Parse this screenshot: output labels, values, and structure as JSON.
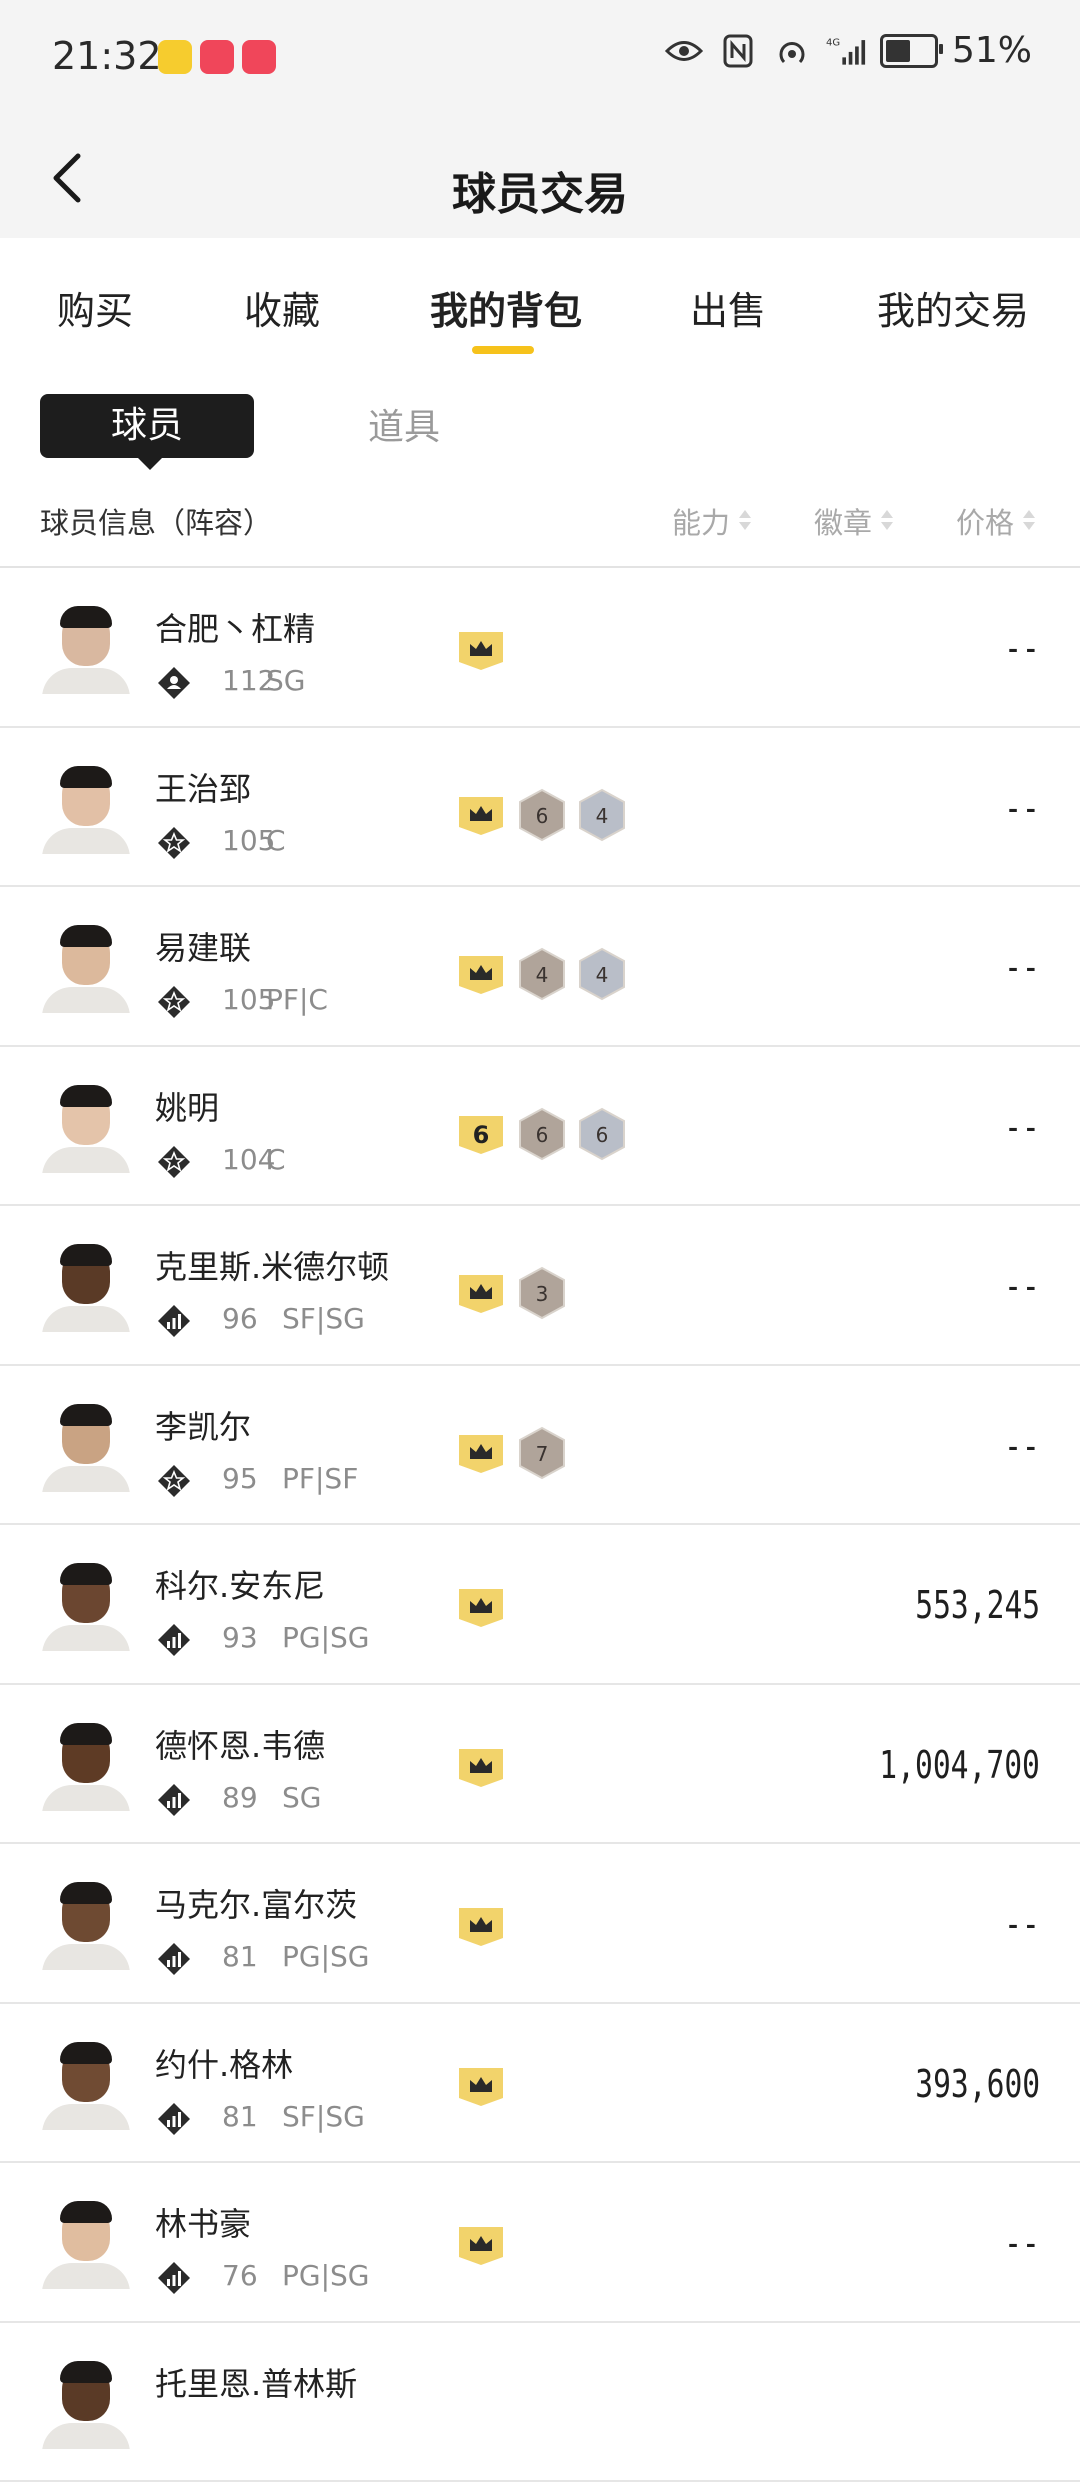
{
  "status": {
    "time": "21:32",
    "battery": "51%",
    "network": "4G"
  },
  "nav": {
    "title": "球员交易"
  },
  "tabs": [
    {
      "label": "购买"
    },
    {
      "label": "收藏"
    },
    {
      "label": "我的背包",
      "active": true
    },
    {
      "label": "出售"
    },
    {
      "label": "我的交易"
    }
  ],
  "subtabs": {
    "active": "球员",
    "other": "道具"
  },
  "columns": {
    "info": "球员信息（阵容）",
    "ability": "能力",
    "badge": "徽章",
    "price": "价格"
  },
  "colors": {
    "accent": "#f6c21b",
    "dark": "#1d1d1d",
    "crown_badge": "#f2d36b",
    "bronze_badge": "#b0a49a",
    "silver_badge": "#b9bec8"
  },
  "players": [
    {
      "name": "合肥丶杠精",
      "rating": "112",
      "pos": "SG",
      "icon": "diamond-person-icon",
      "badges": [
        {
          "type": "crown"
        }
      ],
      "price": "--",
      "skin": "#d9b8a0"
    },
    {
      "name": "王治郅",
      "rating": "105",
      "pos": "C",
      "icon": "diamond-star-icon",
      "badges": [
        {
          "type": "crown"
        },
        {
          "type": "bronze",
          "text": "6"
        },
        {
          "type": "silver",
          "text": "4"
        }
      ],
      "price": "--",
      "skin": "#e2c0a6"
    },
    {
      "name": "易建联",
      "rating": "105",
      "pos": "PF|C",
      "icon": "diamond-star-icon",
      "badges": [
        {
          "type": "crown"
        },
        {
          "type": "bronze",
          "text": "4"
        },
        {
          "type": "silver",
          "text": "4"
        }
      ],
      "price": "--",
      "skin": "#dcb99c"
    },
    {
      "name": "姚明",
      "rating": "104",
      "pos": "C",
      "icon": "diamond-star-icon",
      "badges": [
        {
          "type": "number",
          "text": "6"
        },
        {
          "type": "bronze",
          "text": "6"
        },
        {
          "type": "silver",
          "text": "6"
        }
      ],
      "price": "--",
      "skin": "#e4c4aa"
    },
    {
      "name": "克里斯.米德尔顿",
      "rating": "96",
      "pos": "SF|SG",
      "icon": "diamond-bars-icon",
      "badges": [
        {
          "type": "crown"
        },
        {
          "type": "bronze",
          "text": "3"
        }
      ],
      "price": "--",
      "skin": "#5a3a26"
    },
    {
      "name": "李凯尔",
      "rating": "95",
      "pos": "PF|SF",
      "icon": "diamond-star-icon",
      "badges": [
        {
          "type": "crown"
        },
        {
          "type": "bronze",
          "text": "7"
        }
      ],
      "price": "--",
      "skin": "#c9a383"
    },
    {
      "name": "科尔.安东尼",
      "rating": "93",
      "pos": "PG|SG",
      "icon": "diamond-bars-icon",
      "badges": [
        {
          "type": "crown"
        }
      ],
      "price": "553,245",
      "skin": "#6b4630"
    },
    {
      "name": "德怀恩.韦德",
      "rating": "89",
      "pos": "SG",
      "icon": "diamond-bars-icon",
      "badges": [
        {
          "type": "crown"
        }
      ],
      "price": "1,004,700",
      "skin": "#5e3b25"
    },
    {
      "name": "马克尔.富尔茨",
      "rating": "81",
      "pos": "PG|SG",
      "icon": "diamond-bars-icon",
      "badges": [
        {
          "type": "crown"
        }
      ],
      "price": "--",
      "skin": "#6e4a32"
    },
    {
      "name": "约什.格林",
      "rating": "81",
      "pos": "SF|SG",
      "icon": "diamond-bars-icon",
      "badges": [
        {
          "type": "crown"
        }
      ],
      "price": "393,600",
      "skin": "#704b33"
    },
    {
      "name": "林书豪",
      "rating": "76",
      "pos": "PG|SG",
      "icon": "diamond-bars-icon",
      "badges": [
        {
          "type": "crown"
        }
      ],
      "price": "--",
      "skin": "#e0bd9f"
    },
    {
      "name": "托里恩.普林斯",
      "rating": "",
      "pos": "",
      "icon": "",
      "badges": [],
      "price": "",
      "skin": "#5a3a26"
    }
  ]
}
